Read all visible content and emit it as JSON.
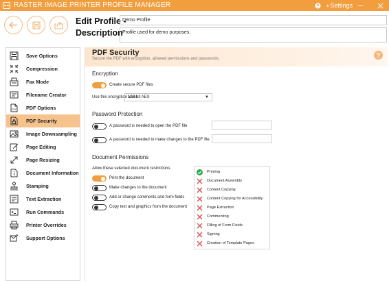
{
  "titlebar": {
    "title": "RASTER IMAGE PRINTER PROFILE MANAGER",
    "help_icon": "?",
    "settings_icon": "gear-icon",
    "settings_label": "Settings",
    "minimize_icon": "minimize-icon",
    "close_icon": "close-icon"
  },
  "header": {
    "edit_profile_label": "Edit Profile -",
    "description_label": "Description",
    "profile_name_value": "Demo Profile",
    "profile_description_value": "Profile used for demo purposes."
  },
  "sidebar": {
    "items": [
      {
        "label": "Save Options",
        "icon": "save-icon",
        "active": false
      },
      {
        "label": "Compression",
        "icon": "compress-icon",
        "active": false
      },
      {
        "label": "Fax Mode",
        "icon": "fax-icon",
        "active": false
      },
      {
        "label": "Filename Creator",
        "icon": "filename-icon",
        "active": false
      },
      {
        "label": "PDF Options",
        "icon": "pdf-icon",
        "active": false
      },
      {
        "label": "PDF Security",
        "icon": "pdf-lock-icon",
        "active": true
      },
      {
        "label": "Image Downsampling",
        "icon": "image-icon",
        "active": false
      },
      {
        "label": "Page Editing",
        "icon": "edit-icon",
        "active": false
      },
      {
        "label": "Page Resizing",
        "icon": "resize-icon",
        "active": false
      },
      {
        "label": "Document Information",
        "icon": "info-icon",
        "active": false
      },
      {
        "label": "Stamping",
        "icon": "stamp-icon",
        "active": false
      },
      {
        "label": "Text Extraction",
        "icon": "text-extract-icon",
        "active": false
      },
      {
        "label": "Run Commands",
        "icon": "terminal-icon",
        "active": false
      },
      {
        "label": "Printer Overrides",
        "icon": "printer-icon",
        "active": false
      },
      {
        "label": "Support Options",
        "icon": "support-icon",
        "active": false
      }
    ]
  },
  "main": {
    "title": "PDF Security",
    "subtitle": "Secure the PDF with encryption, allowed permissions and passwords.",
    "help_icon": "?",
    "encryption": {
      "heading": "Encryption",
      "create_secure_label": "Create secure PDF files",
      "create_secure_on": true,
      "level_label": "Use this encryption level",
      "level_value": "128-bit AES"
    },
    "password": {
      "heading": "Password Protection",
      "open_label": "A password is needed to open the PDF file",
      "open_on": false,
      "change_label": "A password is needed to make changes to the PDF file",
      "change_on": false
    },
    "permissions": {
      "heading": "Document Permissions",
      "allow_label": "Allow these selected document restrictions:",
      "toggles": [
        {
          "label": "Print the document",
          "on": true
        },
        {
          "label": "Make changes to the document",
          "on": false
        },
        {
          "label": "Add or change comments and form fields",
          "on": false
        },
        {
          "label": "Copy text and graphics from the document",
          "on": false
        }
      ],
      "list": [
        {
          "label": "Printing",
          "allowed": true
        },
        {
          "label": "Document Assembly",
          "allowed": false
        },
        {
          "label": "Content Copying",
          "allowed": false
        },
        {
          "label": "Content Copying for Accessibility",
          "allowed": false
        },
        {
          "label": "Page Extraction",
          "allowed": false
        },
        {
          "label": "Commenting",
          "allowed": false
        },
        {
          "label": "Filling of Form Fields",
          "allowed": false
        },
        {
          "label": "Signing",
          "allowed": false
        },
        {
          "label": "Creation of Template Pages",
          "allowed": false
        }
      ]
    }
  },
  "colors": {
    "accent": "#f29e3f",
    "active_nav": "#f7c38d",
    "allowed": "#2ea84a",
    "denied": "#d9534f"
  }
}
